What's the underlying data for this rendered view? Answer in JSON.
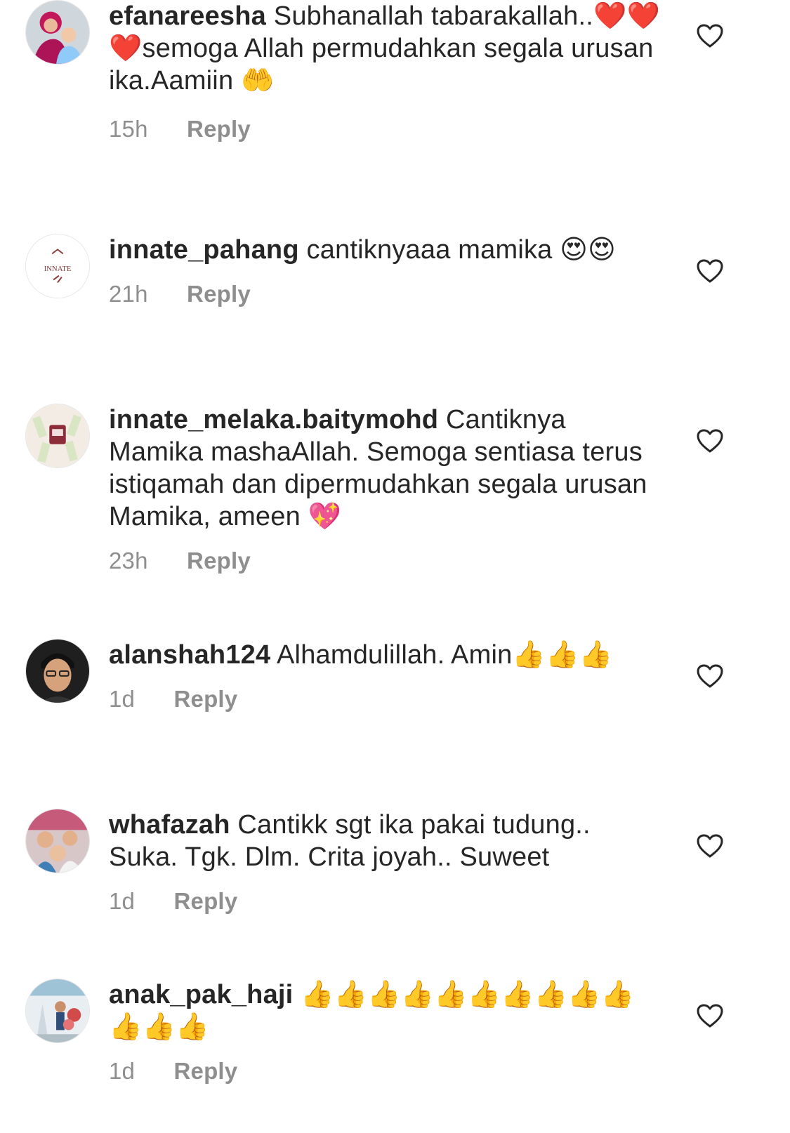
{
  "comments": [
    {
      "username": "efanareesha",
      "text": "Subhanallah tabarakallah..❤️❤️❤️semoga Allah permudahkan segala urusan ika.Aamiin 🤲",
      "time": "15h",
      "reply": "Reply"
    },
    {
      "username": "innate_pahang",
      "text": "cantiknyaaa mamika 😍😍",
      "time": "21h",
      "reply": "Reply",
      "avatar_text": "INNATE"
    },
    {
      "username": "innate_melaka.baitymohd",
      "text": "Cantiknya Mamika mashaAllah. Semoga sentiasa terus istiqamah dan dipermudahkan segala urusan Mamika, ameen 💖",
      "time": "23h",
      "reply": "Reply"
    },
    {
      "username": "alanshah124",
      "text": "Alhamdulillah. Amin👍👍👍",
      "time": "1d",
      "reply": "Reply"
    },
    {
      "username": "whafazah",
      "text": "Cantikk sgt ika pakai tudung.. Suka. Tgk. Dlm. Crita joyah.. Suweet",
      "time": "1d",
      "reply": "Reply"
    },
    {
      "username": "anak_pak_haji",
      "text": "👍👍👍👍👍👍👍👍👍👍👍👍👍",
      "time": "1d",
      "reply": "Reply"
    }
  ],
  "colors": {
    "text": "#262626",
    "muted": "#8e8e8e",
    "heart_outline": "#262626"
  },
  "icons": {
    "like": "heart-outline-icon"
  }
}
